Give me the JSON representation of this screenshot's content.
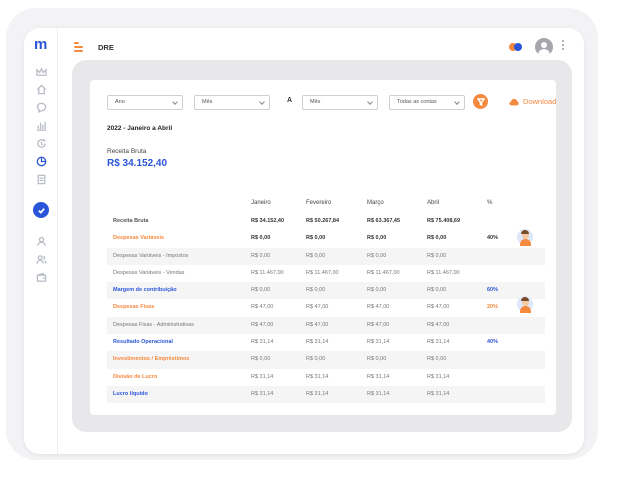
{
  "app": {
    "logo": "m",
    "page_title": "DRE"
  },
  "colors": {
    "brand_blue": "#2b55d8",
    "accent_orange": "#f5893e",
    "sidebar_icon": "#b8bcc6"
  },
  "sidebar": {
    "icons": [
      "crown-icon",
      "home-icon",
      "chat-icon",
      "bar-chart-icon",
      "refresh-icon",
      "pie-chart-icon",
      "document-icon",
      "check-circle-icon",
      "user-icon",
      "users-icon",
      "wallet-icon"
    ],
    "active": "pie-chart-icon"
  },
  "filters": {
    "year": "Ano",
    "month_from": "Mês",
    "range_sep": "A",
    "month_to": "Mês",
    "accounts": "Todas as contas",
    "download_label": "Download"
  },
  "summary": {
    "period": "2022 - Janeiro a Abril",
    "label": "Receita Bruta",
    "value": "R$ 34.152,40"
  },
  "table": {
    "headers": [
      "",
      "Janeiro",
      "Fevereiro",
      "Março",
      "Abril",
      "%"
    ],
    "rows": [
      {
        "label": "Receita Bruta",
        "values": [
          "R$ 34.152,40",
          "R$ 50.267,84",
          "R$ 63.367,45",
          "R$ 75.408,69"
        ],
        "pct": "",
        "style": "bold"
      },
      {
        "label": "Despesas Variáveis",
        "values": [
          "R$ 0,00",
          "R$ 0,00",
          "R$ 0,00",
          "R$ 0,00"
        ],
        "pct": "40%",
        "style": "orange"
      },
      {
        "label": "Despesas Variáveis - Impostos",
        "values": [
          "R$ 0,00",
          "R$ 0,00",
          "R$ 0,00",
          "R$ 0,00"
        ],
        "pct": "",
        "style": "sub"
      },
      {
        "label": "Despesas Variáveis - Vendas",
        "values": [
          "R$ 11.467,00",
          "R$ 11.467,00",
          "R$ 11.467,00",
          "R$ 11.467,00"
        ],
        "pct": "",
        "style": "sub"
      },
      {
        "label": "Margem de contribuição",
        "values": [
          "R$ 0,00",
          "R$ 0,00",
          "R$ 0,00",
          "R$ 0,00"
        ],
        "pct": "60%",
        "style": "blue"
      },
      {
        "label": "Despesas Fixas",
        "values": [
          "R$ 47,00",
          "R$ 47,00",
          "R$ 47,00",
          "R$ 47,00"
        ],
        "pct": "20%",
        "style": "orange"
      },
      {
        "label": "Despesas Fixas - Administrativas",
        "values": [
          "R$ 47,00",
          "R$ 47,00",
          "R$ 47,00",
          "R$ 47,00"
        ],
        "pct": "",
        "style": "sub"
      },
      {
        "label": "Resultado Operacional",
        "values": [
          "R$ 31,14",
          "R$ 31,14",
          "R$ 31,14",
          "R$ 31,14"
        ],
        "pct": "40%",
        "style": "blue"
      },
      {
        "label": "Investimentos / Empréstimos",
        "values": [
          "R$ 0,00",
          "R$ 0,00",
          "R$ 0,00",
          "R$ 0,00"
        ],
        "pct": "",
        "style": "orange"
      },
      {
        "label": "Divisão de Lucro",
        "values": [
          "R$ 31,14",
          "R$ 31,14",
          "R$ 31,14",
          "R$ 31,14"
        ],
        "pct": "",
        "style": "orange"
      },
      {
        "label": "Lucro líquido",
        "values": [
          "R$ 31,14",
          "R$ 31,14",
          "R$ 31,14",
          "R$ 31,14"
        ],
        "pct": "",
        "style": "blue"
      }
    ]
  }
}
